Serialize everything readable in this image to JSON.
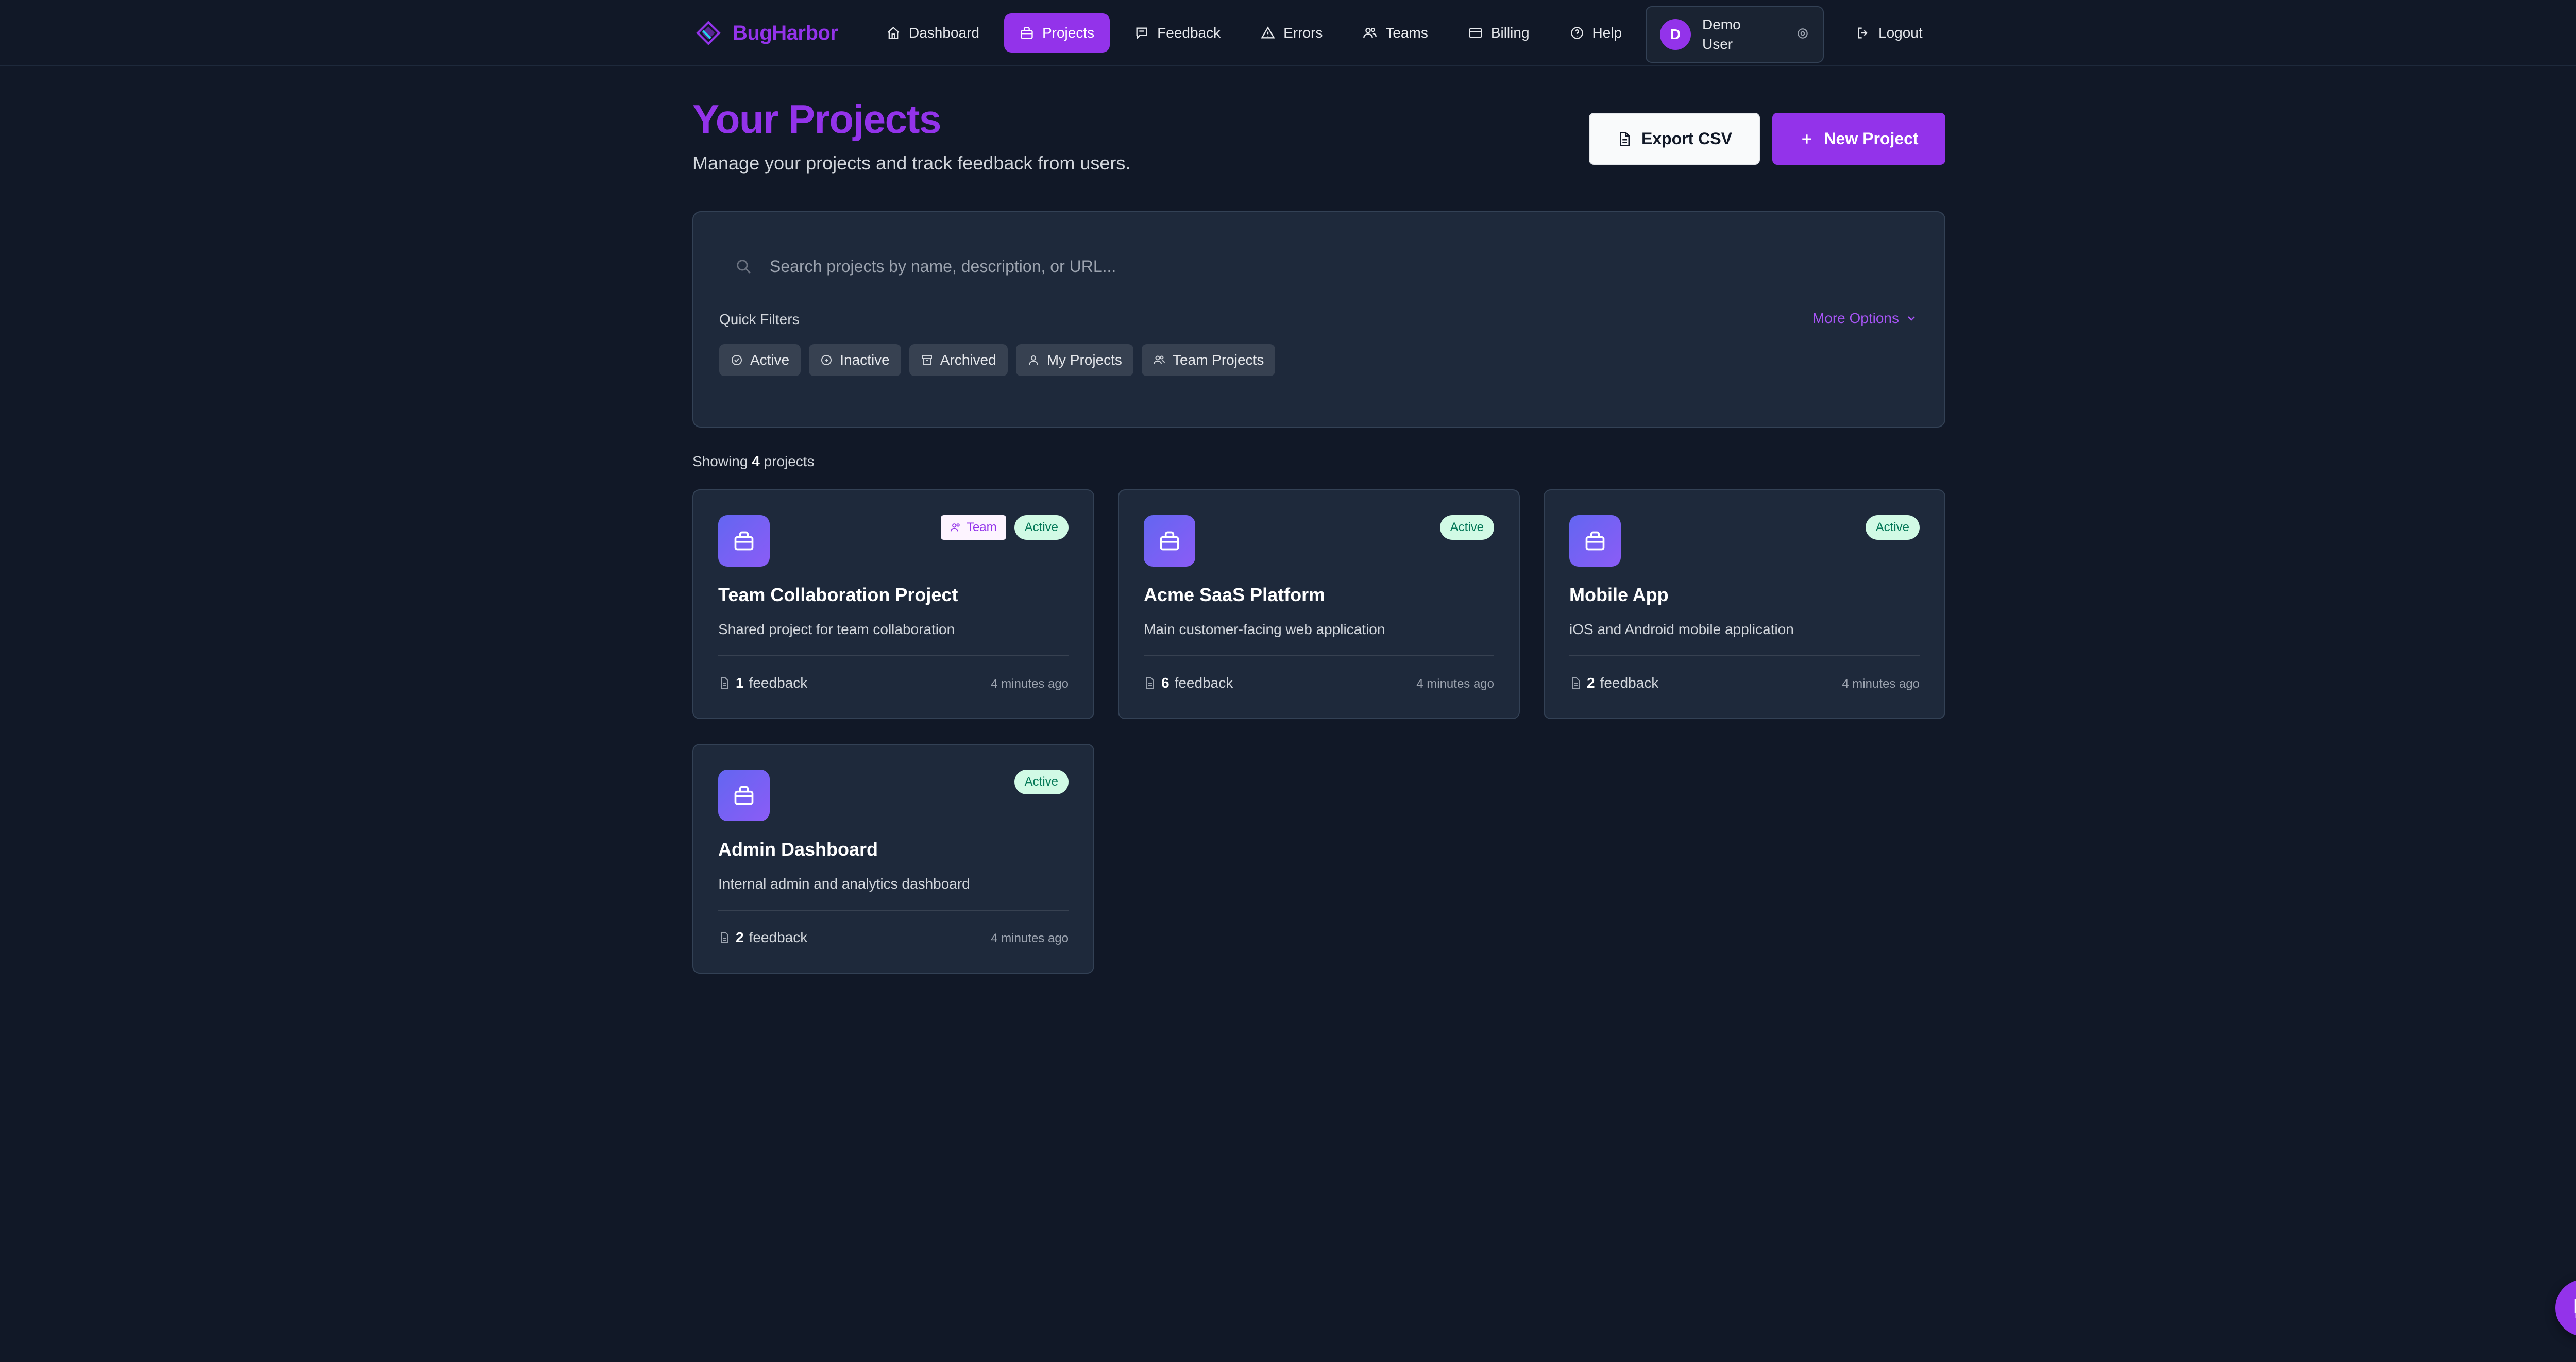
{
  "brand": {
    "name": "BugHarbor",
    "logo_icon": "diamond-logo-icon",
    "color": "#9333ea"
  },
  "nav": {
    "items": [
      {
        "label": "Dashboard",
        "icon": "home-icon",
        "active": false
      },
      {
        "label": "Projects",
        "icon": "briefcase-icon",
        "active": true
      },
      {
        "label": "Feedback",
        "icon": "message-icon",
        "active": false
      },
      {
        "label": "Errors",
        "icon": "warning-icon",
        "active": false
      },
      {
        "label": "Teams",
        "icon": "users-icon",
        "active": false
      },
      {
        "label": "Billing",
        "icon": "credit-card-icon",
        "active": false
      },
      {
        "label": "Help",
        "icon": "help-circle-icon",
        "active": false
      }
    ],
    "user": {
      "initial": "D",
      "name": "Demo User"
    },
    "logout_label": "Logout"
  },
  "header": {
    "title": "Your Projects",
    "subtitle": "Manage your projects and track feedback from users.",
    "export_label": "Export CSV",
    "new_label": "New Project"
  },
  "filters": {
    "search_placeholder": "Search projects by name, description, or URL...",
    "quick_filters_title": "Quick Filters",
    "more_options_label": "More Options",
    "chips": [
      {
        "label": "Active",
        "icon": "check-circle-icon"
      },
      {
        "label": "Inactive",
        "icon": "pause-circle-icon"
      },
      {
        "label": "Archived",
        "icon": "archive-icon"
      },
      {
        "label": "My Projects",
        "icon": "user-icon"
      },
      {
        "label": "Team Projects",
        "icon": "users-icon"
      }
    ]
  },
  "showing": {
    "prefix": "Showing",
    "count": "4",
    "suffix": "projects"
  },
  "projects": [
    {
      "title": "Team Collaboration Project",
      "description": "Shared project for team collaboration",
      "team_badge": "Team",
      "status": "Active",
      "feedback_count": "1",
      "feedback_label": "feedback",
      "time": "4 minutes ago"
    },
    {
      "title": "Acme SaaS Platform",
      "description": "Main customer-facing web application",
      "team_badge": null,
      "status": "Active",
      "feedback_count": "6",
      "feedback_label": "feedback",
      "time": "4 minutes ago"
    },
    {
      "title": "Mobile App",
      "description": "iOS and Android mobile application",
      "team_badge": null,
      "status": "Active",
      "feedback_count": "2",
      "feedback_label": "feedback",
      "time": "4 minutes ago"
    },
    {
      "title": "Admin Dashboard",
      "description": "Internal admin and analytics dashboard",
      "team_badge": null,
      "status": "Active",
      "feedback_count": "2",
      "feedback_label": "feedback",
      "time": "4 minutes ago"
    }
  ],
  "colors": {
    "accent": "#9333ea",
    "background": "#111827",
    "card": "#1e293b",
    "active_badge": "#d1fae5"
  }
}
